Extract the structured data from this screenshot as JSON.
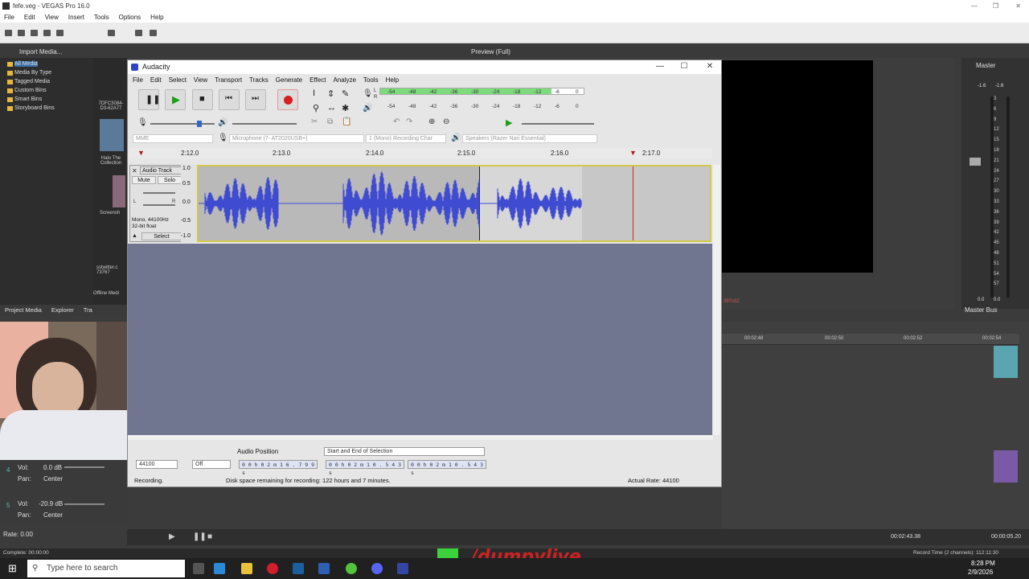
{
  "vegas": {
    "title": "fefe.veg - VEGAS Pro 16.0",
    "menu": [
      "File",
      "Edit",
      "View",
      "Insert",
      "Tools",
      "Options",
      "Help"
    ],
    "import_media": "Import Media...",
    "preview_mode": "Preview (Full)",
    "master": "Master",
    "master_bus": "Master Bus",
    "tree": [
      "All Media",
      "Media By Type",
      "Tagged Media",
      "Custom Bins",
      "Smart Bins",
      "Storyboard Bins"
    ],
    "thumb_labels": [
      "7DFC3084-D3-62A77",
      "Halo The Collection",
      "Screensh",
      "sstwitter.c 73767",
      "Offline Medi"
    ],
    "pane_tabs": [
      "Project Media",
      "Explorer",
      "Tra"
    ],
    "preview_res": "397x32",
    "timeline_ticks": [
      "00:02:48",
      "00:02:50",
      "00:02:52",
      "00:02:54"
    ],
    "track1": {
      "vol_label": "Vol:",
      "vol_value": "0.0 dB",
      "pan_label": "Pan:",
      "pan_value": "Center",
      "num": "4"
    },
    "track2": {
      "vol_label": "Vol:",
      "vol_value": "-20.9 dB",
      "pan_label": "Pan:",
      "pan_value": "Center",
      "num": "5"
    },
    "rate": "Rate: 0.00",
    "status_complete": "Complete: 00:00:00",
    "cursor_time": "00:02:43.38",
    "record_time": "Record Time (2 channels): 112:11:30",
    "end_time": "00:00:05.20",
    "master_scale": [
      "3",
      "6",
      "9",
      "12",
      "15",
      "18",
      "21",
      "24",
      "27",
      "30",
      "33",
      "36",
      "39",
      "42",
      "45",
      "48",
      "51",
      "54",
      "57"
    ],
    "master_levels": [
      "-1.6",
      "-1.6"
    ],
    "master_zero": [
      "0.0",
      "0.0"
    ]
  },
  "audacity": {
    "title": "Audacity",
    "menu": [
      "File",
      "Edit",
      "Select",
      "View",
      "Transport",
      "Tracks",
      "Generate",
      "Effect",
      "Analyze",
      "Tools",
      "Help"
    ],
    "meter_ticks": [
      "-54",
      "-48",
      "-42",
      "-36",
      "-30",
      "-24",
      "-18",
      "-12",
      "-6",
      "0"
    ],
    "meter_record_fill": 0.84,
    "host": "MME",
    "recording_device": "Microphone (7- AT2020USB+)",
    "channels": "1 (Mono) Recording Char",
    "playback_device": "Speakers (Razer Nari Essential)",
    "ruler_ticks": [
      "2:12.0",
      "2:13.0",
      "2:14.0",
      "2:15.0",
      "2:16.0",
      "2:17.0"
    ],
    "track": {
      "name": "Audio Track",
      "mute": "Mute",
      "solo": "Solo",
      "left": "L",
      "right": "R",
      "info1": "Mono, 44100Hz",
      "info2": "32-bit float",
      "select": "Select",
      "scale": [
        "1.0",
        "0.5",
        "0.0",
        "-0.5",
        "-1.0"
      ]
    },
    "project_rate": "44100",
    "snap": "Off",
    "audio_position_label": "Audio Position",
    "selection_mode": "Start and End of Selection",
    "audio_position": "0 0 h 0 2 m 1 6 . 7 9 9 s",
    "sel_start": "0 0 h 0 2 m 1 0 . 5 4 3 s",
    "sel_end": "0 0 h 0 2 m 1 0 . 5 4 3 s",
    "status": "Recording.",
    "disk": "Disk space remaining for recording: 122 hours and 7 minutes.",
    "actual_rate": "Actual Rate: 44100"
  },
  "taskbar": {
    "search_placeholder": "Type here to search",
    "time": "8:28 PM",
    "date": "2/9/2026"
  },
  "watermark": "/dumpylive"
}
